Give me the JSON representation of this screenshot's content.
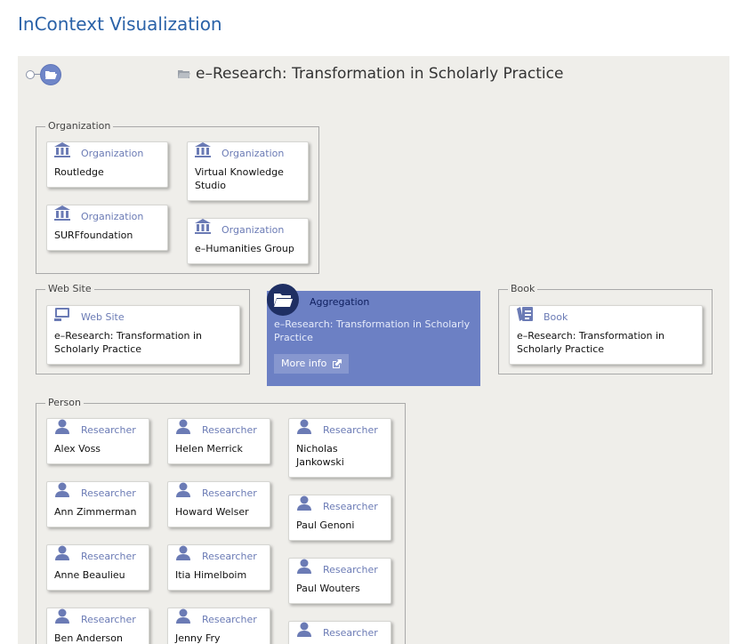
{
  "page_title": "InContext Visualization",
  "header": {
    "title": "e–Research: Transformation in Scholarly Practice"
  },
  "groups": {
    "organization": {
      "label": "Organization",
      "cards": [
        {
          "type": "Organization",
          "name": "Routledge"
        },
        {
          "type": "Organization",
          "name": "Virtual Knowledge Studio"
        },
        {
          "type": "Organization",
          "name": "SURFfoundation"
        },
        {
          "type": "Organization",
          "name": "e–Humanities Group"
        }
      ]
    },
    "website": {
      "label": "Web Site",
      "cards": [
        {
          "type": "Web Site",
          "name": "e–Research: Transformation in Scholarly Practice"
        }
      ]
    },
    "book": {
      "label": "Book",
      "cards": [
        {
          "type": "Book",
          "name": "e–Research: Transformation in Scholarly Practice"
        }
      ]
    },
    "person": {
      "label": "Person",
      "cards": [
        {
          "type": "Researcher",
          "name": "Alex Voss"
        },
        {
          "type": "Researcher",
          "name": "Helen Merrick"
        },
        {
          "type": "Researcher",
          "name": "Nicholas Jankowski"
        },
        {
          "type": "Researcher",
          "name": "Ann Zimmerman"
        },
        {
          "type": "Researcher",
          "name": "Howard Welser"
        },
        {
          "type": "Researcher",
          "name": "Paul Genoni"
        },
        {
          "type": "Researcher",
          "name": "Anne Beaulieu"
        },
        {
          "type": "Researcher",
          "name": "Itia Himelboim"
        },
        {
          "type": "Researcher",
          "name": "Paul Wouters"
        },
        {
          "type": "Researcher",
          "name": "Ben Anderson"
        },
        {
          "type": "Researcher",
          "name": "Jenny Fry"
        },
        {
          "type": "Researcher",
          "name": ""
        }
      ]
    }
  },
  "aggregation": {
    "label": "Aggregation",
    "title": "e–Research: Transformation in Scholarly Practice",
    "more_info": "More info"
  },
  "colors": {
    "title": "#2a62a8",
    "aggregation_bg": "#6c80c4",
    "type_label": "#6b7bb5",
    "badge": "#1f2f63"
  },
  "icons": {
    "organization": "building-icon",
    "website": "monitor-icon",
    "book": "book-icon",
    "person": "person-icon",
    "aggregation": "folder-open-icon",
    "more_info": "external-link-icon"
  }
}
